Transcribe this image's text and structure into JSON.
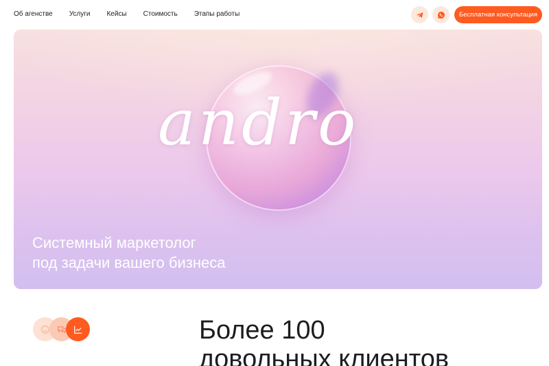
{
  "header": {
    "nav": [
      {
        "label": "Об агенстве"
      },
      {
        "label": "Услуги"
      },
      {
        "label": "Кейсы"
      },
      {
        "label": "Стоимость"
      },
      {
        "label": "Этапы работы"
      }
    ],
    "social": [
      {
        "icon": "telegram-icon"
      },
      {
        "icon": "whatsapp-icon"
      }
    ],
    "cta_label": "Бесплатная консультация"
  },
  "hero": {
    "brand": "andro",
    "tagline_line1": "Системный маркетолог",
    "tagline_line2": "под задачи вашего бизнеса"
  },
  "stats": {
    "icons": [
      "smile-icon",
      "chat-icon",
      "chart-icon"
    ],
    "headline_line1": "Более 100",
    "headline_line2": "довольных клиентов"
  },
  "colors": {
    "accent": "#ff5a1f",
    "accent_light": "#fde8dd",
    "text": "#1d1d1f"
  }
}
